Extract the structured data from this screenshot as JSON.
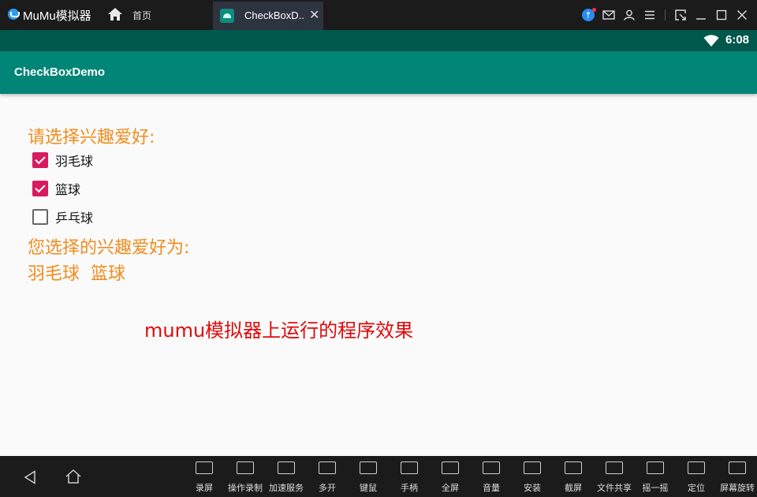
{
  "titlebar": {
    "app_name": "MuMu模拟器",
    "home_tab_label": "首页",
    "active_tab_label": "CheckBoxD..",
    "close_glyph": "✕",
    "actions": [
      "update-icon",
      "mail-icon",
      "user-icon",
      "menu-icon",
      "expand-icon",
      "minimize-icon",
      "maximize-icon",
      "close-icon"
    ]
  },
  "statusbar": {
    "time": "6:08"
  },
  "actionbar": {
    "title": "CheckBoxDemo"
  },
  "content": {
    "prompt": "请选择兴趣爱好:",
    "checkboxes": [
      {
        "label": "羽毛球",
        "checked": true
      },
      {
        "label": "篮球",
        "checked": true
      },
      {
        "label": "乒乓球",
        "checked": false
      }
    ],
    "result_title": "您选择的兴趣爱好为:",
    "result_value": "羽毛球  篮球",
    "caption": "mumu模拟器上运行的程序效果"
  },
  "toolbar": {
    "items": [
      {
        "label": "录屏",
        "icon": "record-icon"
      },
      {
        "label": "操作录制",
        "icon": "macro-icon"
      },
      {
        "label": "加速服务",
        "icon": "rocket-icon"
      },
      {
        "label": "多开",
        "icon": "multi-instance-icon"
      },
      {
        "label": "键鼠",
        "icon": "keyboard-icon"
      },
      {
        "label": "手柄",
        "icon": "gamepad-icon"
      },
      {
        "label": "全屏",
        "icon": "fullscreen-icon"
      },
      {
        "label": "音量",
        "icon": "volume-icon"
      },
      {
        "label": "安装",
        "icon": "apk-icon"
      },
      {
        "label": "截屏",
        "icon": "crop-icon"
      },
      {
        "label": "文件共享",
        "icon": "folder-icon"
      },
      {
        "label": "摇一摇",
        "icon": "shake-icon"
      },
      {
        "label": "定位",
        "icon": "location-icon"
      },
      {
        "label": "屏幕旋转",
        "icon": "rotate-icon"
      }
    ]
  },
  "colors": {
    "statusbar": "#00574b",
    "actionbar": "#008577",
    "accent": "#d81b60",
    "prompt_text": "#f28c1c",
    "caption_text": "#e00a0a"
  }
}
